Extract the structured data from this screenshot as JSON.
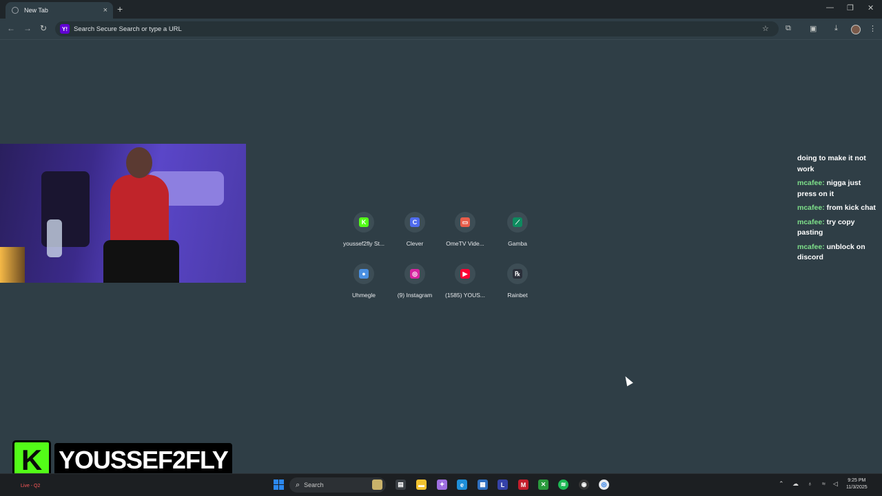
{
  "browser": {
    "tab_title": "New Tab",
    "tab_close": "×",
    "new_tab": "+",
    "minimize": "—",
    "restore": "❐",
    "close": "✕",
    "omnibox_placeholder": "Search Secure Search or type a URL",
    "search_engine_badge": "Y!"
  },
  "shortcuts": [
    {
      "label": "youssef2fly St...",
      "glyph": "K",
      "color": "#53fc18",
      "icon": "kick-icon"
    },
    {
      "label": "Clever",
      "glyph": "C",
      "color": "#4f6bed",
      "icon": "clever-icon"
    },
    {
      "label": "OmeTV Vide...",
      "glyph": "▭",
      "color": "#e85d4a",
      "icon": "ometv-icon"
    },
    {
      "label": "Gamba",
      "glyph": "⟋",
      "color": "#0e8a5f",
      "icon": "gamba-icon"
    },
    {
      "label": "Uhmegle",
      "glyph": "●",
      "color": "#4a90e2",
      "icon": "uhmegle-icon"
    },
    {
      "label": "(9) Instagram",
      "glyph": "◎",
      "color": "#d6249f",
      "icon": "instagram-icon"
    },
    {
      "label": "(1585) YOUS...",
      "glyph": "▶",
      "color": "#ff0033",
      "icon": "youtube-icon"
    },
    {
      "label": "Rainbet",
      "glyph": "℞",
      "color": "#2a2f3a",
      "icon": "rainbet-icon"
    }
  ],
  "chat": {
    "partial_line": "... ...... ..... .. ..",
    "messages": [
      {
        "user": "",
        "text": "doing to make it not work"
      },
      {
        "user": "mcafee:",
        "text": "nigga just press on it"
      },
      {
        "user": "mcafee:",
        "text": "from kick chat"
      },
      {
        "user": "mcafee:",
        "text": "try copy pasting"
      },
      {
        "user": "mcafee:",
        "text": "unblock on discord"
      }
    ]
  },
  "stream_overlay": {
    "kick_logo": "K",
    "channel_name": "YOUSSEF2FLY"
  },
  "taskbar": {
    "left_status": "Live - Q2",
    "search_label": "Search",
    "time": "9:25 PM",
    "date": "11/3/2025"
  }
}
